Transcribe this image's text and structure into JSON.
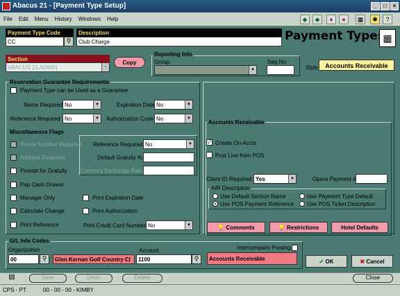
{
  "window": {
    "title": "Abacus 21 - [Payment Type Setup]"
  },
  "menu": [
    "File",
    "Edit",
    "Menu",
    "History",
    "Windows",
    "Help"
  ],
  "page_title": "Payment Types",
  "payment_type_code": {
    "label": "Payment Type Code",
    "value": "CC"
  },
  "description": {
    "label": "Description",
    "value": "Club Charge"
  },
  "section": {
    "label": "Section",
    "value": "ABACUS 21 ADMIN"
  },
  "copy_button": "Copy",
  "reporting_info": {
    "title": "Reporting Info",
    "group_label": "Group",
    "group_value": "",
    "seq_label": "Seq No.",
    "seq_value": ""
  },
  "style": {
    "label": "Style",
    "value": "Accounts Receivable"
  },
  "reservation": {
    "title": "Reservation Guarantee Requirements",
    "guarantee_label": "Payment Type can be Used as a Guarantee",
    "name_required_label": "Name Required",
    "name_required_value": "No",
    "expiration_label": "Expiration Date",
    "expiration_value": "No",
    "reference_required_label": "Reference Required",
    "reference_required_value": "No",
    "auth_code_label": "Authorization Code",
    "auth_code_value": "No"
  },
  "misc": {
    "title": "Miscellaneous Flags",
    "phone_required": "Phone Number Required",
    "address_required": "Address Required",
    "prompt_gratuity": "Prompt for Gratuity",
    "pop_cash_drawer": "Pop Cash Drawer",
    "manager_only": "Manager Only",
    "calculate_change": "Calculate Change",
    "print_reference": "Print Reference",
    "reference_required_label": "Reference Required",
    "reference_required_value": "No",
    "default_gratuity_label": "Default Gratuity %",
    "default_gratuity_value": "",
    "currency_rate_label": "Currency Exchange Rate",
    "currency_rate_value": "",
    "print_expiration": "Print Expiration Date",
    "print_authorization": "Print Authorization",
    "print_cc_number_label": "Print Credit Card Number",
    "print_cc_number_value": "No"
  },
  "ar": {
    "title": "Accounts Receivable",
    "create_on_accts": "Create On-Accts",
    "post_live": "Post Live from POS",
    "client_id_label": "Client ID Required",
    "client_id_value": "Yes",
    "opera_payment_label": "Opera Payment #",
    "opera_payment_value": "",
    "ar_desc_title": "A/R Description",
    "opt_default_section": "Use Default Section Name",
    "opt_payment_type_default": "Use Payment Type Default",
    "opt_pos_reference": "Use POS Payment Reference",
    "opt_pos_ticket": "Use POS Ticket Description",
    "comments_button": "Comments",
    "restrictions_button": "Restrictions",
    "hotel_defaults_button": "Hotel Defaults"
  },
  "gl": {
    "title": "G/L Info Codes",
    "organization_label": "Organization",
    "organization_value": "00",
    "organization_name": "Glen Kernan Golf  Country Cl",
    "account_label": "Account",
    "account_value": "1100",
    "account_name": "Accounts Receivable",
    "intercompany_label": "Intercompany Posting"
  },
  "ok_button": "OK",
  "cancel_button": "Cancel",
  "bottom_toolbar": {
    "save": "Save",
    "undo": "Undo",
    "delete": "Delete",
    "close": "Close"
  },
  "status": {
    "left": "CPS - PT",
    "mid": "00 - 00 - 00 - KIMBY"
  },
  "colors": {
    "background": "#4a7a72",
    "title_blue": "#1c3f66",
    "pink": "#f09aaa",
    "yellow": "#fff7a0"
  }
}
